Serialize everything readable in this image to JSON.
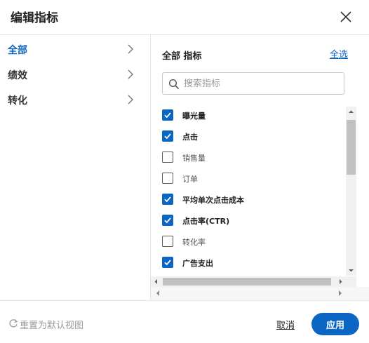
{
  "header": {
    "title": "编辑指标"
  },
  "sidebar": {
    "items": [
      {
        "label": "全部",
        "active": true
      },
      {
        "label": "绩效",
        "active": false
      },
      {
        "label": "转化",
        "active": false
      }
    ]
  },
  "panel": {
    "title": "全部 指标",
    "select_all": "全选",
    "search": {
      "placeholder": "搜索指标",
      "value": ""
    },
    "metrics": [
      {
        "label": "曝光量",
        "checked": true
      },
      {
        "label": "点击",
        "checked": true
      },
      {
        "label": "销售量",
        "checked": false
      },
      {
        "label": "订单",
        "checked": false
      },
      {
        "label": "平均单次点击成本",
        "checked": true
      },
      {
        "label": "点击率(CTR)",
        "checked": true
      },
      {
        "label": "转化率",
        "checked": false
      },
      {
        "label": "广告支出",
        "checked": true
      }
    ]
  },
  "footer": {
    "reset": "重置为默认视图",
    "cancel": "取消",
    "apply": "应用"
  },
  "colors": {
    "accent": "#0a66c2",
    "border": "#e6e6e6",
    "muted": "#9a9a9a"
  }
}
